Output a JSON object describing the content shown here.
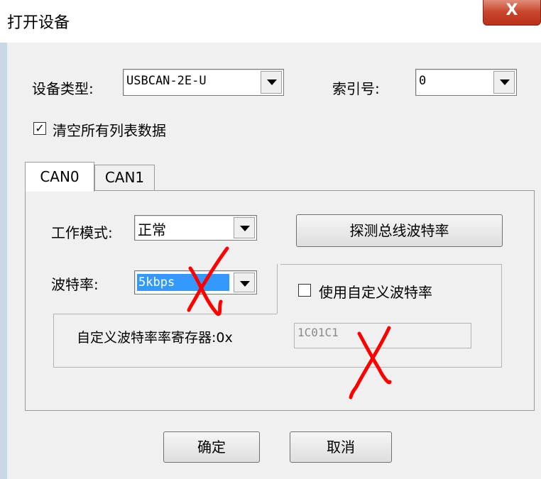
{
  "window": {
    "title": "打开设备",
    "close_glyph": "X"
  },
  "device": {
    "type_label": "设备类型:",
    "type_value": "USBCAN-2E-U",
    "index_label": "索引号:",
    "index_value": "0"
  },
  "clear_option": {
    "label": "清空所有列表数据",
    "checked": true,
    "check_glyph": "✓"
  },
  "tabs": [
    {
      "label": "CAN0",
      "active": true
    },
    {
      "label": "CAN1",
      "active": false
    }
  ],
  "can": {
    "mode_label": "工作模式:",
    "mode_value": "正常",
    "detect_button": "探测总线波特率",
    "baud_label": "波特率:",
    "baud_value": "5kbps",
    "custom_baud_label": "使用自定义波特率",
    "custom_baud_checked": false,
    "register_label": "自定义波特率率寄存器:0x",
    "register_value": "1C01C1"
  },
  "buttons": {
    "ok": "确定",
    "cancel": "取消"
  },
  "annotations": {
    "color": "#ff0000"
  }
}
